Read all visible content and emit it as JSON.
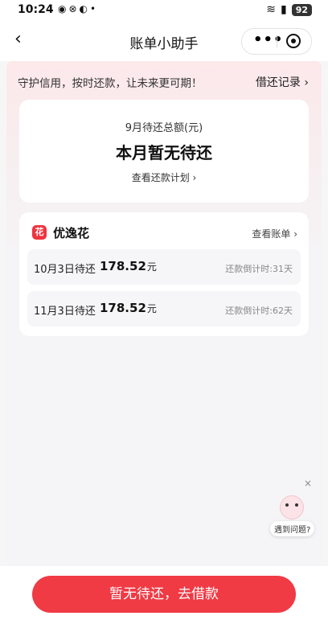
{
  "status": {
    "time": "10:24",
    "battery": "92"
  },
  "nav": {
    "title": "账单小助手",
    "more": "•••"
  },
  "banner": {
    "slogan": "守护信用，按时还款，让未来更可期！",
    "record": "借还记录 ›"
  },
  "summary": {
    "label": "9月待还总额(元)",
    "status": "本月暂无待还",
    "plan_link": "查看还款计划 ›"
  },
  "product": {
    "icon": "花",
    "name": "优逸花",
    "bill_link": "查看账单 ›",
    "bills": [
      {
        "date": "10月3日待还",
        "amount": "178.52",
        "unit": "元",
        "countdown": "还款倒计时:31天"
      },
      {
        "date": "11月3日待还",
        "amount": "178.52",
        "unit": "元",
        "countdown": "还款倒计时:62天"
      }
    ]
  },
  "helper": {
    "close": "×",
    "text": "遇到问题?"
  },
  "cta": {
    "label": "暂无待还，去借款"
  },
  "colors": {
    "accent": "#f03a44",
    "logo": "#ef3340"
  }
}
